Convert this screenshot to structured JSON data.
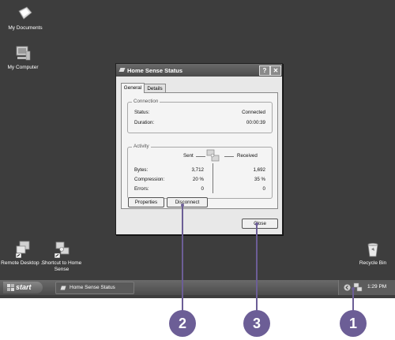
{
  "desktop": {
    "icons": [
      {
        "label": "My Documents"
      },
      {
        "label": "My Computer"
      },
      {
        "label": "Remote Desktop ..."
      },
      {
        "label": "Shortcut to Home Sense"
      },
      {
        "label": "Recycle Bin"
      }
    ]
  },
  "dialog": {
    "title": "Home Sense Status",
    "help_button": "?",
    "close_x": "✕",
    "tabs": [
      {
        "label": "General",
        "active": true
      },
      {
        "label": "Details",
        "active": false
      }
    ],
    "connection": {
      "legend": "Connection",
      "status_label": "Status:",
      "status_value": "Connected",
      "duration_label": "Duration:",
      "duration_value": "00:00:39"
    },
    "activity": {
      "legend": "Activity",
      "sent_label": "Sent",
      "received_label": "Received",
      "rows": [
        {
          "label": "Bytes:",
          "sent": "3,712",
          "received": "1,692"
        },
        {
          "label": "Compression:",
          "sent": "20 %",
          "received": "35 %"
        },
        {
          "label": "Errors:",
          "sent": "0",
          "received": "0"
        }
      ]
    },
    "properties_button": "Properties",
    "disconnect_button": "Disconnect",
    "close_button": "Close"
  },
  "taskbar": {
    "start_label": "start",
    "task_label": "Home Sense Status",
    "clock": "1:29 PM"
  },
  "callouts": [
    "2",
    "3",
    "1"
  ],
  "colors": {
    "callout": "#6c5e96",
    "desktop": "#3d3d3d"
  }
}
